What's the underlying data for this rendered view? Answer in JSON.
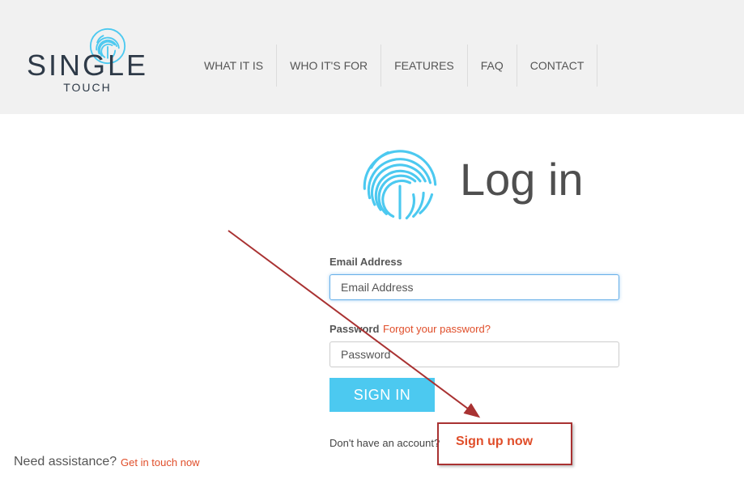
{
  "brand": {
    "name": "SINGLE",
    "sub": "TOUCH"
  },
  "nav": {
    "items": [
      {
        "label": "WHAT IT IS"
      },
      {
        "label": "WHO IT'S FOR"
      },
      {
        "label": "FEATURES"
      },
      {
        "label": "FAQ"
      },
      {
        "label": "CONTACT"
      }
    ]
  },
  "login": {
    "title": "Log in",
    "email_label": "Email Address",
    "email_placeholder": "Email Address",
    "password_label": "Password",
    "forgot_link": "Forgot your password?",
    "password_placeholder": "Password",
    "submit_label": "SIGN IN",
    "no_account_text": "Don't have an account?",
    "signup_link": "Sign up now"
  },
  "footer": {
    "assist_text": "Need assistance?",
    "assist_link": "Get in touch now"
  },
  "colors": {
    "accent": "#4cc9f0",
    "link": "#e04e2a",
    "annotation": "#a93232",
    "header_bg": "#f1f1f1"
  },
  "icons": {
    "logo": "fingerprint-icon",
    "hero": "fingerprint-icon"
  }
}
